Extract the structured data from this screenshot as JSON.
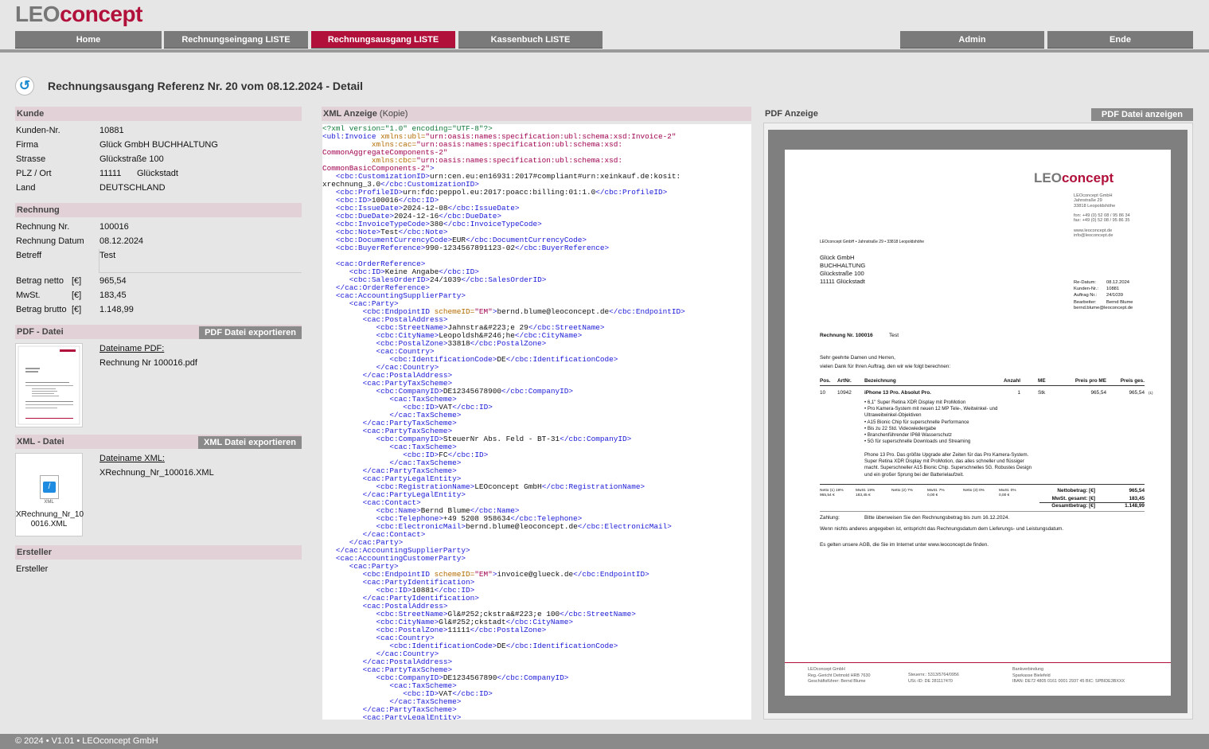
{
  "app": {
    "logo_part1": "LEO",
    "logo_part2": "concept"
  },
  "nav": {
    "home": "Home",
    "rechnungseingang": "Rechnungseingang LISTE",
    "rechnungsausgang": "Rechnungsausgang LISTE",
    "kassenbuch": "Kassenbuch LISTE",
    "admin": "Admin",
    "ende": "Ende"
  },
  "page": {
    "title": "Rechnungsausgang Referenz Nr. 20 vom 08.12.2024 - Detail"
  },
  "kunde": {
    "heading": "Kunde",
    "kundennr_label": "Kunden-Nr.",
    "kundennr": "10881",
    "firma_label": "Firma",
    "firma": "Glück GmbH BUCHHALTUNG",
    "strasse_label": "Strasse",
    "strasse": "Glückstraße 100",
    "plz_label": "PLZ / Ort",
    "plz": "11111",
    "ort": "Glückstadt",
    "land_label": "Land",
    "land": "DEUTSCHLAND"
  },
  "rechnung": {
    "heading": "Rechnung",
    "nr_label": "Rechnung Nr.",
    "nr": "100016",
    "datum_label": "Rechnung Datum",
    "datum": "08.12.2024",
    "betreff_label": "Betreff",
    "betreff": "Test",
    "netto_label": "Betrag netto",
    "netto_unit": "[€]",
    "netto": "965,54",
    "mwst_label": "MwSt.",
    "mwst_unit": "[€]",
    "mwst": "183,45",
    "brutto_label": "Betrag brutto",
    "brutto_unit": "[€]",
    "brutto": "1.148,99"
  },
  "pdf_datei": {
    "heading": "PDF - Datei",
    "export_button": "PDF Datei exportieren",
    "filename_label": "Dateiname PDF:",
    "filename": "Rechnung Nr  100016.pdf"
  },
  "xml_datei": {
    "heading": "XML - Datei",
    "export_button": "XML Datei exportieren",
    "filename_label": "Dateiname XML:",
    "filename": "XRechnung_Nr_100016.XML",
    "icon_caption_1": "XRechnung_Nr_10",
    "icon_caption_2": "0016.XML",
    "icon_text": "XML"
  },
  "ersteller": {
    "heading": "Ersteller",
    "value": "Ersteller"
  },
  "xml_anzeige": {
    "heading": "XML Anzeige",
    "heading_suffix": "(Kopie)"
  },
  "xml_lines": [
    [
      [
        "p",
        "<?xml version=\"1.0\" encoding=\"UTF-8\"?>"
      ]
    ],
    [
      [
        "t",
        "<ubl:Invoice "
      ],
      [
        "a",
        "xmlns:ubl="
      ],
      [
        "s",
        "\"urn:oasis:names:specification:ubl:schema:xsd:Invoice-2\""
      ]
    ],
    [
      [
        "c",
        "           "
      ],
      [
        "a",
        "xmlns:cac="
      ],
      [
        "s",
        "\"urn:oasis:names:specification:ubl:schema:xsd:"
      ]
    ],
    [
      [
        "s",
        "CommonAggregateComponents-2\""
      ]
    ],
    [
      [
        "c",
        "           "
      ],
      [
        "a",
        "xmlns:cbc="
      ],
      [
        "s",
        "\"urn:oasis:names:specification:ubl:schema:xsd:"
      ]
    ],
    [
      [
        "s",
        "CommonBasicComponents-2\""
      ],
      [
        "t",
        ">"
      ]
    ],
    [
      [
        "c",
        "   "
      ],
      [
        "t",
        "<cbc:CustomizationID>"
      ],
      [
        "c",
        "urn:cen.eu:en16931:2017#compliant#urn:xeinkauf.de:kosit:"
      ]
    ],
    [
      [
        "c",
        "xrechnung_3.0"
      ],
      [
        "t",
        "</cbc:CustomizationID>"
      ]
    ],
    [
      [
        "c",
        "   "
      ],
      [
        "t",
        "<cbc:ProfileID>"
      ],
      [
        "c",
        "urn:fdc:peppol.eu:2017:poacc:billing:01:1.0"
      ],
      [
        "t",
        "</cbc:ProfileID>"
      ]
    ],
    [
      [
        "c",
        "   "
      ],
      [
        "t",
        "<cbc:ID>"
      ],
      [
        "c",
        "100016"
      ],
      [
        "t",
        "</cbc:ID>"
      ]
    ],
    [
      [
        "c",
        "   "
      ],
      [
        "t",
        "<cbc:IssueDate>"
      ],
      [
        "c",
        "2024-12-08"
      ],
      [
        "t",
        "</cbc:IssueDate>"
      ]
    ],
    [
      [
        "c",
        "   "
      ],
      [
        "t",
        "<cbc:DueDate>"
      ],
      [
        "c",
        "2024-12-16"
      ],
      [
        "t",
        "</cbc:DueDate>"
      ]
    ],
    [
      [
        "c",
        "   "
      ],
      [
        "t",
        "<cbc:InvoiceTypeCode>"
      ],
      [
        "c",
        "380"
      ],
      [
        "t",
        "</cbc:InvoiceTypeCode>"
      ]
    ],
    [
      [
        "c",
        "   "
      ],
      [
        "t",
        "<cbc:Note>"
      ],
      [
        "c",
        "Test"
      ],
      [
        "t",
        "</cbc:Note>"
      ]
    ],
    [
      [
        "c",
        "   "
      ],
      [
        "t",
        "<cbc:DocumentCurrencyCode>"
      ],
      [
        "c",
        "EUR"
      ],
      [
        "t",
        "</cbc:DocumentCurrencyCode>"
      ]
    ],
    [
      [
        "c",
        "   "
      ],
      [
        "t",
        "<cbc:BuyerReference>"
      ],
      [
        "c",
        "990-1234567891123-02"
      ],
      [
        "t",
        "</cbc:BuyerReference>"
      ]
    ],
    [
      [
        "c",
        ""
      ]
    ],
    [
      [
        "c",
        "   "
      ],
      [
        "t",
        "<cac:OrderReference>"
      ]
    ],
    [
      [
        "c",
        "      "
      ],
      [
        "t",
        "<cbc:ID>"
      ],
      [
        "c",
        "Keine Angabe"
      ],
      [
        "t",
        "</cbc:ID>"
      ]
    ],
    [
      [
        "c",
        "      "
      ],
      [
        "t",
        "<cbc:SalesOrderID>"
      ],
      [
        "c",
        "24/1039"
      ],
      [
        "t",
        "</cbc:SalesOrderID>"
      ]
    ],
    [
      [
        "c",
        "   "
      ],
      [
        "t",
        "</cac:OrderReference>"
      ]
    ],
    [
      [
        "c",
        "   "
      ],
      [
        "t",
        "<cac:AccountingSupplierParty>"
      ]
    ],
    [
      [
        "c",
        "      "
      ],
      [
        "t",
        "<cac:Party>"
      ]
    ],
    [
      [
        "c",
        "         "
      ],
      [
        "t",
        "<cbc:EndpointID "
      ],
      [
        "a",
        "schemeID="
      ],
      [
        "s",
        "\"EM\""
      ],
      [
        "t",
        ">"
      ],
      [
        "c",
        "bernd.blume@leoconcept.de"
      ],
      [
        "t",
        "</cbc:EndpointID>"
      ]
    ],
    [
      [
        "c",
        "         "
      ],
      [
        "t",
        "<cac:PostalAddress>"
      ]
    ],
    [
      [
        "c",
        "            "
      ],
      [
        "t",
        "<cbc:StreetName>"
      ],
      [
        "c",
        "Jahnstra&#223;e 29"
      ],
      [
        "t",
        "</cbc:StreetName>"
      ]
    ],
    [
      [
        "c",
        "            "
      ],
      [
        "t",
        "<cbc:CityName>"
      ],
      [
        "c",
        "Leopoldsh&#246;he"
      ],
      [
        "t",
        "</cbc:CityName>"
      ]
    ],
    [
      [
        "c",
        "            "
      ],
      [
        "t",
        "<cbc:PostalZone>"
      ],
      [
        "c",
        "33818"
      ],
      [
        "t",
        "</cbc:PostalZone>"
      ]
    ],
    [
      [
        "c",
        "            "
      ],
      [
        "t",
        "<cac:Country>"
      ]
    ],
    [
      [
        "c",
        "               "
      ],
      [
        "t",
        "<cbc:IdentificationCode>"
      ],
      [
        "c",
        "DE"
      ],
      [
        "t",
        "</cbc:IdentificationCode>"
      ]
    ],
    [
      [
        "c",
        "            "
      ],
      [
        "t",
        "</cac:Country>"
      ]
    ],
    [
      [
        "c",
        "         "
      ],
      [
        "t",
        "</cac:PostalAddress>"
      ]
    ],
    [
      [
        "c",
        "         "
      ],
      [
        "t",
        "<cac:PartyTaxScheme>"
      ]
    ],
    [
      [
        "c",
        "            "
      ],
      [
        "t",
        "<cbc:CompanyID>"
      ],
      [
        "c",
        "DE12345678900"
      ],
      [
        "t",
        "</cbc:CompanyID>"
      ]
    ],
    [
      [
        "c",
        "               "
      ],
      [
        "t",
        "<cac:TaxScheme>"
      ]
    ],
    [
      [
        "c",
        "                  "
      ],
      [
        "t",
        "<cbc:ID>"
      ],
      [
        "c",
        "VAT"
      ],
      [
        "t",
        "</cbc:ID>"
      ]
    ],
    [
      [
        "c",
        "               "
      ],
      [
        "t",
        "</cac:TaxScheme>"
      ]
    ],
    [
      [
        "c",
        "         "
      ],
      [
        "t",
        "</cac:PartyTaxScheme>"
      ]
    ],
    [
      [
        "c",
        "         "
      ],
      [
        "t",
        "<cac:PartyTaxScheme>"
      ]
    ],
    [
      [
        "c",
        "            "
      ],
      [
        "t",
        "<cbc:CompanyID>"
      ],
      [
        "c",
        "SteuerNr Abs. Feld - BT-31"
      ],
      [
        "t",
        "</cbc:CompanyID>"
      ]
    ],
    [
      [
        "c",
        "               "
      ],
      [
        "t",
        "<cac:TaxScheme>"
      ]
    ],
    [
      [
        "c",
        "                  "
      ],
      [
        "t",
        "<cbc:ID>"
      ],
      [
        "c",
        "FC"
      ],
      [
        "t",
        "</cbc:ID>"
      ]
    ],
    [
      [
        "c",
        "               "
      ],
      [
        "t",
        "</cac:TaxScheme>"
      ]
    ],
    [
      [
        "c",
        "         "
      ],
      [
        "t",
        "</cac:PartyTaxScheme>"
      ]
    ],
    [
      [
        "c",
        "         "
      ],
      [
        "t",
        "<cac:PartyLegalEntity>"
      ]
    ],
    [
      [
        "c",
        "            "
      ],
      [
        "t",
        "<cbc:RegistrationName>"
      ],
      [
        "c",
        "LEOconcept GmbH"
      ],
      [
        "t",
        "</cbc:RegistrationName>"
      ]
    ],
    [
      [
        "c",
        "         "
      ],
      [
        "t",
        "</cac:PartyLegalEntity>"
      ]
    ],
    [
      [
        "c",
        "         "
      ],
      [
        "t",
        "<cac:Contact>"
      ]
    ],
    [
      [
        "c",
        "            "
      ],
      [
        "t",
        "<cbc:Name>"
      ],
      [
        "c",
        "Bernd Blume"
      ],
      [
        "t",
        "</cbc:Name>"
      ]
    ],
    [
      [
        "c",
        "            "
      ],
      [
        "t",
        "<cbc:Telephone>"
      ],
      [
        "c",
        "+49 5208 958634"
      ],
      [
        "t",
        "</cbc:Telephone>"
      ]
    ],
    [
      [
        "c",
        "            "
      ],
      [
        "t",
        "<cbc:ElectronicMail>"
      ],
      [
        "c",
        "bernd.blume@leoconcept.de"
      ],
      [
        "t",
        "</cbc:ElectronicMail>"
      ]
    ],
    [
      [
        "c",
        "         "
      ],
      [
        "t",
        "</cac:Contact>"
      ]
    ],
    [
      [
        "c",
        "      "
      ],
      [
        "t",
        "</cac:Party>"
      ]
    ],
    [
      [
        "c",
        "   "
      ],
      [
        "t",
        "</cac:AccountingSupplierParty>"
      ]
    ],
    [
      [
        "c",
        "   "
      ],
      [
        "t",
        "<cac:AccountingCustomerParty>"
      ]
    ],
    [
      [
        "c",
        "      "
      ],
      [
        "t",
        "<cac:Party>"
      ]
    ],
    [
      [
        "c",
        "         "
      ],
      [
        "t",
        "<cbc:EndpointID "
      ],
      [
        "a",
        "schemeID="
      ],
      [
        "s",
        "\"EM\""
      ],
      [
        "t",
        ">"
      ],
      [
        "c",
        "invoice@glueck.de"
      ],
      [
        "t",
        "</cbc:EndpointID>"
      ]
    ],
    [
      [
        "c",
        "         "
      ],
      [
        "t",
        "<cac:PartyIdentification>"
      ]
    ],
    [
      [
        "c",
        "            "
      ],
      [
        "t",
        "<cbc:ID>"
      ],
      [
        "c",
        "10881"
      ],
      [
        "t",
        "</cbc:ID>"
      ]
    ],
    [
      [
        "c",
        "         "
      ],
      [
        "t",
        "</cac:PartyIdentification>"
      ]
    ],
    [
      [
        "c",
        "         "
      ],
      [
        "t",
        "<cac:PostalAddress>"
      ]
    ],
    [
      [
        "c",
        "            "
      ],
      [
        "t",
        "<cbc:StreetName>"
      ],
      [
        "c",
        "Gl&#252;ckstra&#223;e 100"
      ],
      [
        "t",
        "</cbc:StreetName>"
      ]
    ],
    [
      [
        "c",
        "            "
      ],
      [
        "t",
        "<cbc:CityName>"
      ],
      [
        "c",
        "Gl&#252;ckstadt"
      ],
      [
        "t",
        "</cbc:CityName>"
      ]
    ],
    [
      [
        "c",
        "            "
      ],
      [
        "t",
        "<cbc:PostalZone>"
      ],
      [
        "c",
        "11111"
      ],
      [
        "t",
        "</cbc:PostalZone>"
      ]
    ],
    [
      [
        "c",
        "            "
      ],
      [
        "t",
        "<cac:Country>"
      ]
    ],
    [
      [
        "c",
        "               "
      ],
      [
        "t",
        "<cbc:IdentificationCode>"
      ],
      [
        "c",
        "DE"
      ],
      [
        "t",
        "</cbc:IdentificationCode>"
      ]
    ],
    [
      [
        "c",
        "            "
      ],
      [
        "t",
        "</cac:Country>"
      ]
    ],
    [
      [
        "c",
        "         "
      ],
      [
        "t",
        "</cac:PostalAddress>"
      ]
    ],
    [
      [
        "c",
        "         "
      ],
      [
        "t",
        "<cac:PartyTaxScheme>"
      ]
    ],
    [
      [
        "c",
        "            "
      ],
      [
        "t",
        "<cbc:CompanyID>"
      ],
      [
        "c",
        "DE1234567890"
      ],
      [
        "t",
        "</cbc:CompanyID>"
      ]
    ],
    [
      [
        "c",
        "               "
      ],
      [
        "t",
        "<cac:TaxScheme>"
      ]
    ],
    [
      [
        "c",
        "                  "
      ],
      [
        "t",
        "<cbc:ID>"
      ],
      [
        "c",
        "VAT"
      ],
      [
        "t",
        "</cbc:ID>"
      ]
    ],
    [
      [
        "c",
        "               "
      ],
      [
        "t",
        "</cac:TaxScheme>"
      ]
    ],
    [
      [
        "c",
        "         "
      ],
      [
        "t",
        "</cac:PartyTaxScheme>"
      ]
    ],
    [
      [
        "c",
        "         "
      ],
      [
        "t",
        "<cac:PartyLegalEntity>"
      ]
    ]
  ],
  "pdf_anzeige": {
    "heading": "PDF Anzeige",
    "show_button": "PDF Datei anzeigen"
  },
  "pdf_doc": {
    "logo1": "LEO",
    "logo2": "concept",
    "company_block": [
      "LEOconcept GmbH",
      "Jahnstraße 29",
      "33818 Leopoldshöhe",
      "",
      "fon: +49 (0) 52 08 / 95 86 34",
      "fax: +49 (0) 52 08 / 95 86 35",
      "",
      "www.leoconcept.de",
      "info@leoconcept.de"
    ],
    "sender_line": "LEOconcept GmbH • Jahnstraße 29 • 33818 Leopoldshöhe",
    "address": [
      "Glück GmbH",
      "BUCHHALTUNG",
      "Glückstraße 100",
      "11111  Glückstadt"
    ],
    "meta_labels": [
      "Re-Datum:",
      "Kunden-Nr.:",
      "Auftrag Nr.:",
      "Bearbeiter:"
    ],
    "meta_values": [
      "08.12.2024",
      "10881",
      "24/1039",
      "Bernd Blume"
    ],
    "meta_email": "bernd.blume@leoconcept.de",
    "rechnung_label": "Rechnung Nr.  100016",
    "betreff": "Test",
    "greeting1": "Sehr geehrte Damen und Herren,",
    "greeting2": "vielen Dank für Ihren Auftrag, den wir wie folgt berechnen:",
    "table_head": [
      "Pos.",
      "ArtNr.",
      "Bezeichnung",
      "Anzahl",
      "ME",
      "Preis pro ME",
      "Preis ges."
    ],
    "row": [
      "10",
      "10942",
      "iPhone 13 Pro. Absolut Pro.",
      "1",
      "Stk",
      "965,54",
      "965,54",
      "(1)"
    ],
    "bullets": [
      "• 6,1\" Super Retina XDR Display mit ProMotion",
      "• Pro Kamera-System mit neuen 12 MP Tele-, Weitwinkel- und",
      "   Ultraweitwinkel-Objektiven",
      "• A15 Bionic Chip für superschnelle Performance",
      "• Bis zu 22 Std. Videowiedergabe",
      "• Branchenführender IP68 Wasserschutz",
      "• 5G für superschnelle Downloads und Streaming"
    ],
    "desc": [
      "Phone 13 Pro. Das größte Upgrade aller Zeiten für das Pro Kamera-System.",
      "Super Retina XDR Display mit ProMotion, das alles schneller und flüssiger",
      "macht. Superschneller A15 Bionic Chip. Superschnelles 5G. Robustes Design",
      "und ein großer Sprung bei der Batterielaufzeit."
    ],
    "tax_cols": [
      [
        "Netto (1) 19%",
        "965,54 €"
      ],
      [
        "MwSt. 19%",
        "183,45 €"
      ],
      [
        "Netto (2) 7%",
        ""
      ],
      [
        "MwSt. 7%",
        "0,00 €"
      ],
      [
        "Netto (3) 0%",
        ""
      ],
      [
        "MwSt. 0%",
        "0,00 €"
      ]
    ],
    "sum_labels": [
      "Nettobetrag: [€]",
      "MwSt. gesamt: [€]",
      "Gesamtbetrag: [€]"
    ],
    "sum_values": [
      "965,54",
      "183,45",
      "1.148,99"
    ],
    "zahlung_label": "Zahlung:",
    "zahlung_text": "Bitte überweisen Sie den Rechnungsbetrag bis zum 16.12.2024.",
    "note1": "Wenn nichts anderes angegeben ist, entspricht das Rechnungsdatum dem Lieferungs- und Leistungsdatum.",
    "note2": "Es gelten unsere AGB, die Sie im Internet unter www.leoconcept.de finden.",
    "foot_col1": [
      "LEOconcept GmbH",
      "Reg.-Gericht Detmold HRB 7630",
      "Geschäftsführer: Bernd Blume"
    ],
    "foot_col2": [
      "Steuernr.:   5313/5764/0956",
      "USt.-ID:     DE 281117470"
    ],
    "foot_col3": [
      "Bankverbindung",
      "Sparkasse Bielefeld",
      "IBAN: DE72 4805 0161 0001 2937 45       BIC: SPBIDE3BXXX"
    ]
  },
  "footer": {
    "text": "© 2024 • V1.01 • LEOconcept GmbH"
  },
  "colors": {
    "accent": "#b0103a",
    "nav_bg": "#7a7a7a",
    "section_bg": "#e2d2d8"
  }
}
